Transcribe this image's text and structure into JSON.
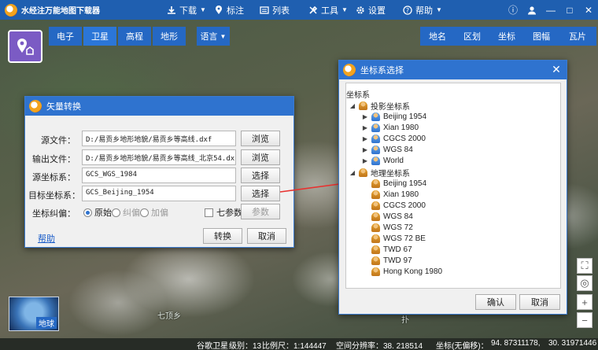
{
  "app": {
    "title": "水经注万能地图下载器",
    "menu": [
      {
        "label": "下载",
        "icon": "download-icon"
      },
      {
        "label": "标注",
        "icon": "pin-icon"
      },
      {
        "label": "列表",
        "icon": "list-icon"
      },
      {
        "label": "工具",
        "icon": "tools-icon"
      },
      {
        "label": "设置",
        "icon": "gear-icon"
      },
      {
        "label": "帮助",
        "icon": "help-icon"
      }
    ],
    "window_buttons": [
      "ⓘ",
      "👤",
      "—",
      "□",
      "✕"
    ]
  },
  "map_types": [
    "电子",
    "卫星",
    "高程",
    "地形"
  ],
  "active_map_type": "卫星",
  "language_label": "语言",
  "right_tabs": [
    "地名",
    "区划",
    "坐标",
    "图幅",
    "瓦片"
  ],
  "globe_label": "地球",
  "map_labels": [
    "七顶乡",
    "扑"
  ],
  "status": {
    "source": "谷歌卫星",
    "level": "级别：13",
    "scale": "比例尺：1:144447",
    "resolution": "空间分辨率：38. 218514",
    "coord_label": "坐标(无偏移)：",
    "lon": "94. 87311178,",
    "lat": "30. 31971446"
  },
  "vector_dialog": {
    "title": "矢量转换",
    "rows": [
      {
        "label": "源文件：",
        "value": "D:/易贡乡地形地貌/易贡乡等高线.dxf",
        "button": "浏览"
      },
      {
        "label": "输出文件：",
        "value": "D:/易贡乡地形地貌/易贡乡等高线_北京54.dxf",
        "button": "浏览"
      },
      {
        "label": "源坐标系：",
        "value": "GCS_WGS_1984",
        "button": "选择"
      },
      {
        "label": "目标坐标系：",
        "value": "GCS_Beijing_1954",
        "button": "选择"
      }
    ],
    "offset_label": "坐标纠偏：",
    "radios": [
      "原始",
      "纠偏",
      "加偏"
    ],
    "seven_param_label": "七参数",
    "params_button": "参数",
    "help_link": "帮助",
    "convert_button": "转换",
    "cancel_button": "取消"
  },
  "coord_dialog": {
    "title": "坐标系选择",
    "root_label": "坐标系",
    "projected": {
      "label": "投影坐标系",
      "items": [
        "Beijing 1954",
        "Xian 1980",
        "CGCS 2000",
        "WGS 84",
        "World"
      ]
    },
    "geographic": {
      "label": "地理坐标系",
      "items": [
        "Beijing 1954",
        "Xian 1980",
        "CGCS 2000",
        "WGS 84",
        "WGS 72",
        "WGS 72 BE",
        "TWD 67",
        "TWD 97",
        "Hong Kong 1980"
      ]
    },
    "ok_button": "确认",
    "cancel_button": "取消"
  },
  "colors": {
    "topbar": "#1f5fb0",
    "accent": "#2f73cf",
    "arrow": "#e8312f"
  }
}
